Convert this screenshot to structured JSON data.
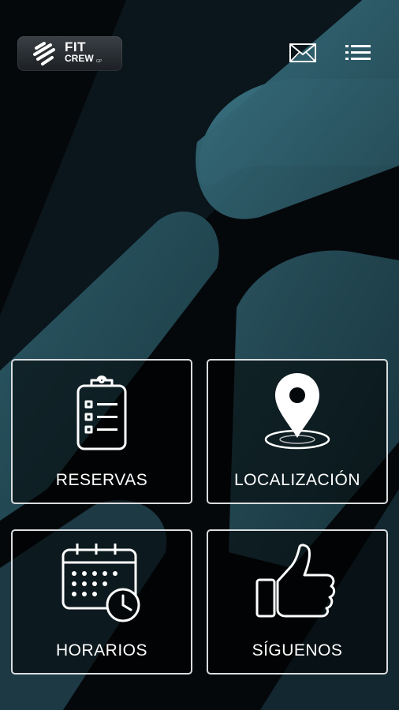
{
  "brand": {
    "logo_primary": "FIT",
    "logo_secondary": "CREW",
    "logo_tertiary": "GP"
  },
  "header": {
    "mail_icon": "envelope-icon",
    "menu_icon": "list-menu-icon"
  },
  "tiles": [
    {
      "label": "RESERVAS",
      "icon": "clipboard-checklist-icon"
    },
    {
      "label": "LOCALIZACIÓN",
      "icon": "map-pin-icon"
    },
    {
      "label": "HORARIOS",
      "icon": "calendar-clock-icon"
    },
    {
      "label": "SÍGUENOS",
      "icon": "thumbs-up-icon"
    }
  ],
  "colors": {
    "background": "#05080b",
    "accent_teal": "#2f5a66",
    "tile_border": "#d9dde0",
    "text": "#ffffff"
  }
}
